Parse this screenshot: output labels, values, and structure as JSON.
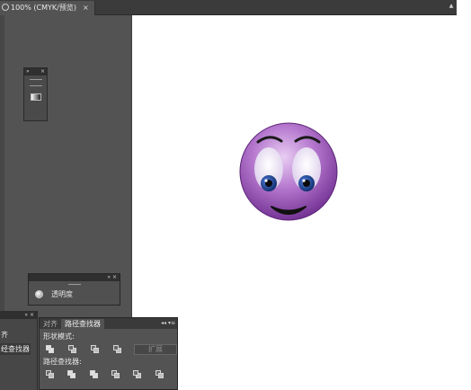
{
  "document_tab": {
    "title": "100% (CMYK/预览)",
    "close_glyph": "×"
  },
  "panel_controls": {
    "collapse_glyph": "»",
    "close_glyph": "×",
    "menu_glyph": "«"
  },
  "transparency_panel": {
    "label": "透明度"
  },
  "left_dock": {
    "label_partial_1": "齐",
    "label_partial_2": "经查找器"
  },
  "pathfinder_panel": {
    "tab_align": "对齐",
    "tab_pathfinder": "路径查找器",
    "menu_glyph": "◂◂ ▾≡",
    "shape_modes_label": "形状模式:",
    "expand_label": "扩展",
    "pathfinders_label": "路径查找器:"
  },
  "icons": {
    "tab_icon": "document-icon",
    "transparency_icon": "transparency-icon",
    "gradient_icon": "gradient-icon"
  },
  "artwork": {
    "subject": "smiley-face",
    "face_color": "#9b59b6",
    "eye_color": "#1f3d8a"
  }
}
